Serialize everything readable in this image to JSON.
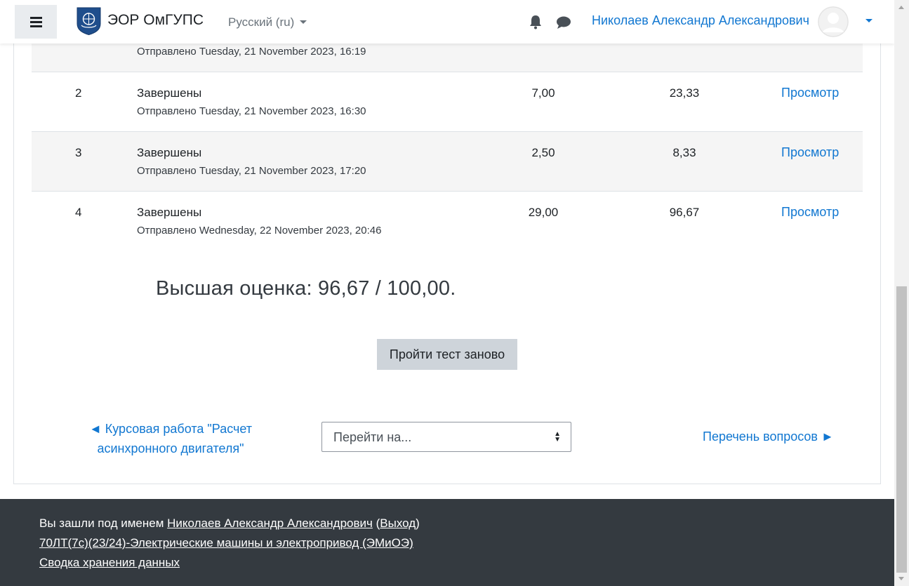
{
  "navbar": {
    "brand": "ЭОР ОмГУПС",
    "language": "Русский (ru)",
    "user_name": "Николаев Александр Александрович"
  },
  "attempts": [
    {
      "number": "",
      "state": "",
      "submitted": "Отправлено Tuesday, 21 November 2023, 16:19",
      "marks": "",
      "grade": "",
      "review": ""
    },
    {
      "number": "2",
      "state": "Завершены",
      "submitted": "Отправлено Tuesday, 21 November 2023, 16:30",
      "marks": "7,00",
      "grade": "23,33",
      "review": "Просмотр"
    },
    {
      "number": "3",
      "state": "Завершены",
      "submitted": "Отправлено Tuesday, 21 November 2023, 17:20",
      "marks": "2,50",
      "grade": "8,33",
      "review": "Просмотр"
    },
    {
      "number": "4",
      "state": "Завершены",
      "submitted": "Отправлено Wednesday, 22 November 2023, 20:46",
      "marks": "29,00",
      "grade": "96,67",
      "review": "Просмотр"
    }
  ],
  "summary": {
    "best_grade": "Высшая оценка: 96,67 / 100,00.",
    "retake_button": "Пройти тест заново"
  },
  "activity_nav": {
    "prev_line1": "◄ Курсовая работа \"Расчет",
    "prev_line2": "асинхронного двигателя\"",
    "jump_placeholder": "Перейти на...",
    "next": "Перечень вопросов ►"
  },
  "footer": {
    "logged_in_prefix": "Вы зашли под именем ",
    "user_name": "Николаев Александр Александрович",
    "logout_open": " (",
    "logout": "Выход",
    "logout_close": ")",
    "course": "70ЛТ(7с)(23/24)-Электрические машины и электропривод (ЭМиОЭ)",
    "data_retention": "Сводка хранения данных"
  }
}
